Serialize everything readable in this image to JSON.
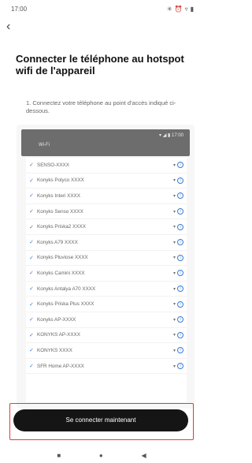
{
  "status_bar": {
    "time": "17:00",
    "icons": [
      "bluetooth-icon",
      "alarm-icon",
      "wifi-icon",
      "battery-icon"
    ],
    "icon_glyphs": [
      "✳",
      "⏰",
      "▿",
      "▮"
    ]
  },
  "header": {
    "back_glyph": "‹",
    "title": "Connecter le téléphone au hotspot wifi de l'appareil"
  },
  "instruction": "1. Connectez votre téléphone au point d'accès indiqué ci-dessous.",
  "phone_mock": {
    "status_glyphs": "▾ ◢ ▮ 17:00",
    "header_label": "Wi-Fi"
  },
  "wifi_networks": [
    "SENSO-XXXX",
    "Konyks Polyco XXXX",
    "Konyks Interi XXXX",
    "Konyks Senso XXXX",
    "Konyks Priska2 XXXX",
    "Konyks A79 XXXX",
    "Konyks Pluviose XXXX",
    "Konyks Camini XXXX",
    "Konyks Antalya A70 XXXX",
    "Konyks Priska Plus XXXX",
    "Konyks AP-XXXX",
    "KONYKS AP-XXXX",
    "KONYKS XXXX",
    "SFR Home AP-XXXX"
  ],
  "row_glyphs": {
    "check": "✓",
    "signal": "▾",
    "info": "i"
  },
  "connect_button_label": "Se connecter maintenant",
  "nav_bar": {
    "recents": "■",
    "home": "●",
    "back": "◀"
  },
  "colors": {
    "accent": "#3a7bd5",
    "highlight_frame": "#e53935",
    "button": "#151515"
  }
}
